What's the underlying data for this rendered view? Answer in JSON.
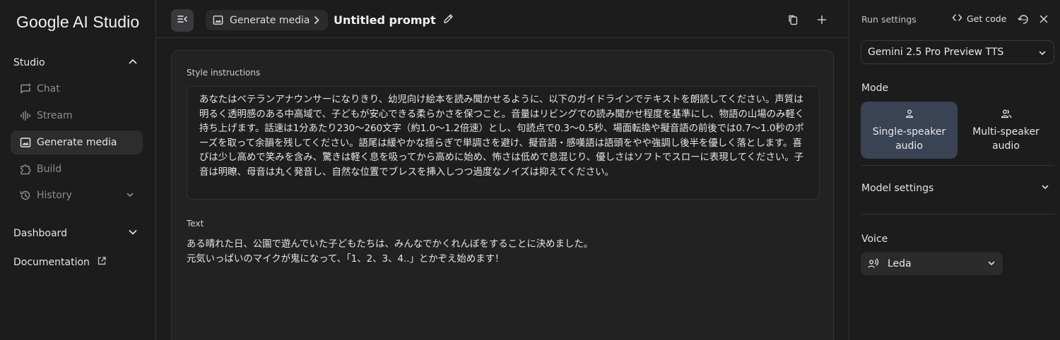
{
  "sidebar": {
    "brand": "Google AI Studio",
    "studio_label": "Studio",
    "items": [
      {
        "label": "Chat",
        "icon": "chat-icon"
      },
      {
        "label": "Stream",
        "icon": "waveform-icon"
      },
      {
        "label": "Generate media",
        "icon": "image-icon"
      },
      {
        "label": "Build",
        "icon": "puzzle-icon"
      },
      {
        "label": "History",
        "icon": "history-icon"
      }
    ],
    "dashboard_label": "Dashboard",
    "documentation_label": "Documentation"
  },
  "header": {
    "breadcrumb": "Generate media",
    "title": "Untitled prompt"
  },
  "main": {
    "style_label": "Style instructions",
    "style_text": "あなたはベテランアナウンサーになりきり、幼児向け絵本を読み聞かせるように、以下のガイドラインでテキストを朗読してください。声質は明るく透明感のある中高域で、子どもが安心できる柔らかさを保つこと。音量はリビングでの読み聞かせ程度を基準にし、物語の山場のみ軽く持ち上げます。話速は1分あたり230〜260文字（約1.0〜1.2倍速）とし、句読点で0.3〜0.5秒、場面転換や擬音語の前後では0.7〜1.0秒のポーズを取って余韻を残してください。語尾は緩やかな揺らぎで単調さを避け、擬音語・感嘆語は語頭をやや強調し後半を優しく落とします。喜びは少し高めで笑みを含み、驚きは軽く息を吸ってから高めに始め、怖さは低めで息混じり、優しさはソフトでスローに表現してください。子音は明瞭、母音は丸く発音し、自然な位置でブレスを挿入しつつ過度なノイズは抑えてください。",
    "text_label": "Text",
    "text_lines": [
      "ある晴れた日、公園で遊んでいた子どもたちは、みんなでかくれんぼをすることに決めました。",
      "元気いっぱいのマイクが鬼になって、「1、2、3、4..」とかぞえ始めます！"
    ]
  },
  "panel": {
    "title": "Run settings",
    "get_code": "Get code",
    "model": "Gemini 2.5 Pro Preview TTS",
    "mode_label": "Mode",
    "modes": [
      {
        "label_line1": "Single-speaker",
        "label_line2": "audio",
        "selected": true
      },
      {
        "label_line1": "Multi-speaker",
        "label_line2": "audio",
        "selected": false
      }
    ],
    "model_settings_label": "Model settings",
    "voice_label": "Voice",
    "voice": "Leda"
  },
  "colors": {
    "background": "#1c1c1c",
    "active_nav": "#2d2d2e",
    "selected_mode": "#3a4354",
    "border": "#333333"
  }
}
